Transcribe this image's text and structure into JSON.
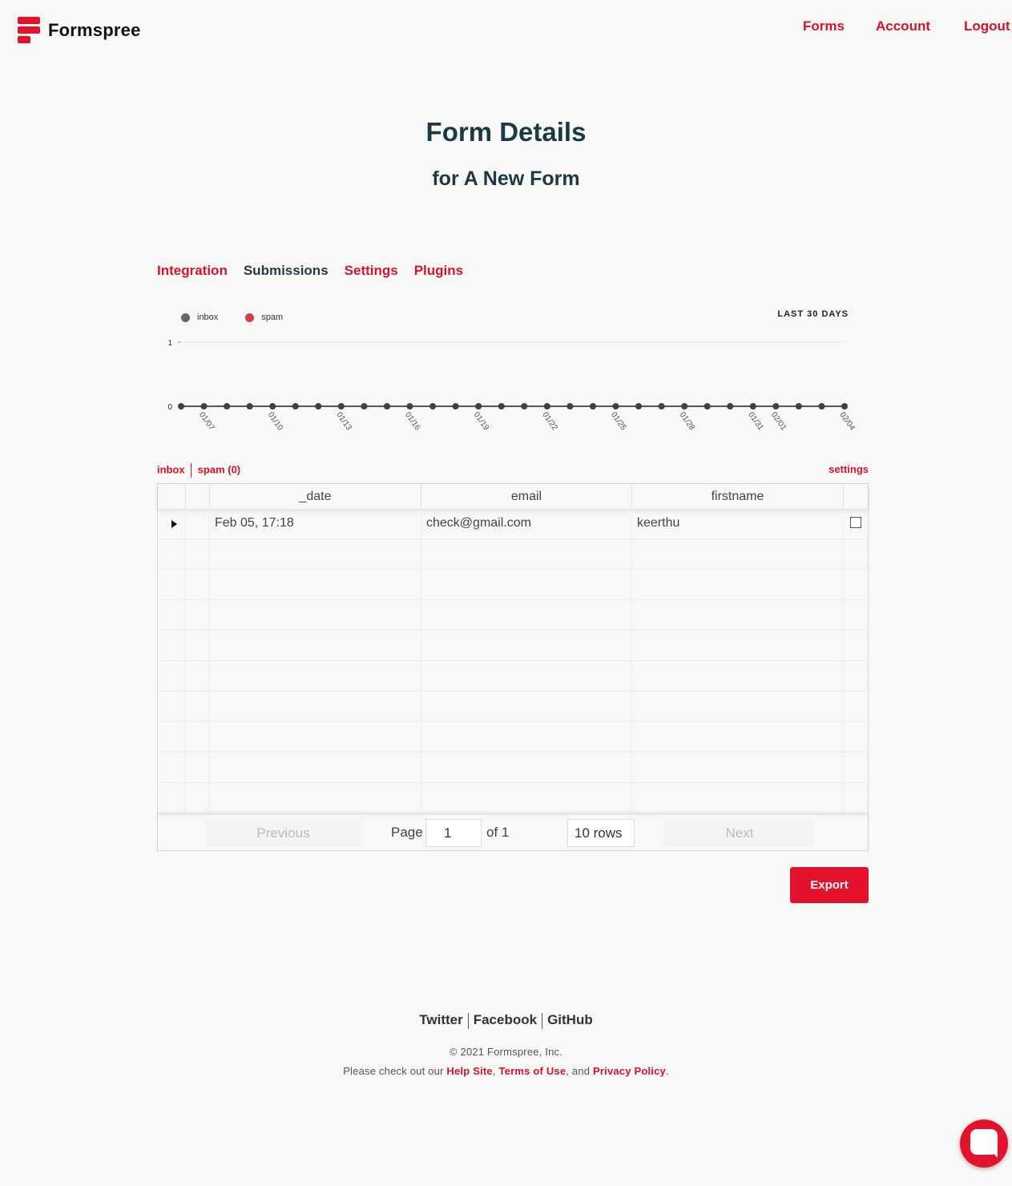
{
  "header": {
    "brand": "Formspree",
    "nav": [
      "Forms",
      "Account",
      "Logout"
    ]
  },
  "page": {
    "title": "Form Details",
    "subtitle": "for A New Form"
  },
  "tabs": [
    {
      "label": "Integration",
      "active": false
    },
    {
      "label": "Submissions",
      "active": true
    },
    {
      "label": "Settings",
      "active": false
    },
    {
      "label": "Plugins",
      "active": false
    }
  ],
  "chart_data": {
    "type": "line",
    "range_label": "LAST 30 DAYS",
    "legend": [
      {
        "name": "inbox",
        "color": "#666666"
      },
      {
        "name": "spam",
        "color": "#d63a4f"
      }
    ],
    "x_tick_labels": [
      "01/07",
      "01/10",
      "01/13",
      "01/16",
      "01/19",
      "01/22",
      "01/25",
      "01/28",
      "01/31",
      "02/01",
      "02/04"
    ],
    "y_ticks": [
      "1",
      "0"
    ],
    "ylim": [
      0,
      1
    ],
    "points": 30,
    "values": [
      0,
      0,
      0,
      0,
      0,
      0,
      0,
      0,
      0,
      0,
      0,
      0,
      0,
      0,
      0,
      0,
      0,
      0,
      0,
      0,
      0,
      0,
      0,
      0,
      0,
      0,
      0,
      0,
      0,
      0
    ]
  },
  "subnav": {
    "inbox": "inbox",
    "spam": "spam (0)",
    "settings": "settings"
  },
  "table": {
    "columns": [
      "_date",
      "email",
      "firstname"
    ],
    "rows": [
      {
        "date": "Feb 05, 17:18",
        "email": "check@gmail.com",
        "firstname": "keerthu",
        "status_color": "#6b8e23"
      }
    ],
    "empty_rows": 9
  },
  "pager": {
    "previous": "Previous",
    "page_label": "Page",
    "page_value": "1",
    "of_label": "of 1",
    "rows_value": "10 rows",
    "next": "Next"
  },
  "export_label": "Export",
  "footer": {
    "links": [
      "Twitter",
      "Facebook",
      "GitHub"
    ],
    "copyright": "© 2021 Formspree, Inc.",
    "policy_prefix": "Please check out our ",
    "help": "Help Site",
    "terms": "Terms of Use",
    "and": ", and ",
    "privacy": "Privacy Policy",
    "comma": ", ",
    "period": "."
  },
  "colors": {
    "accent": "#e5122e",
    "text_dark": "#1a3a44"
  }
}
